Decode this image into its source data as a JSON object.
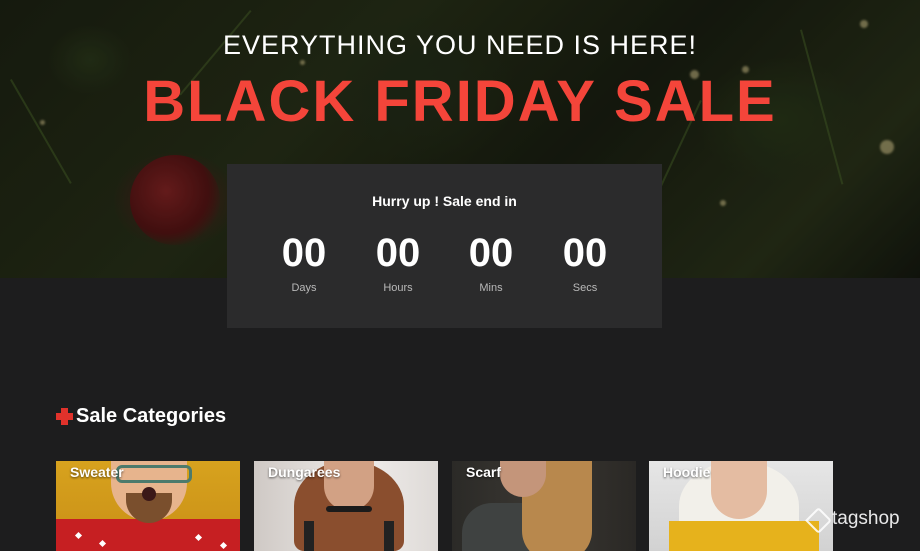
{
  "hero": {
    "tagline": "EVERYTHING YOU NEED IS HERE!",
    "headline": "BLACK FRIDAY SALE"
  },
  "countdown": {
    "title": "Hurry up ! Sale end in",
    "units": [
      {
        "value": "00",
        "label": "Days"
      },
      {
        "value": "00",
        "label": "Hours"
      },
      {
        "value": "00",
        "label": "Mins"
      },
      {
        "value": "00",
        "label": "Secs"
      }
    ]
  },
  "section": {
    "title": "Sale Categories",
    "icon": "plus-icon"
  },
  "categories": [
    {
      "label": "Sweater"
    },
    {
      "label": "Dungarees"
    },
    {
      "label": "Scarf"
    },
    {
      "label": "Hoodie"
    }
  ],
  "watermark": {
    "text": "tagshop",
    "icon": "tag-icon"
  },
  "colors": {
    "accent": "#f4453a",
    "page_background": "#1d1d1e",
    "countdown_panel": "#2b2b2c"
  }
}
